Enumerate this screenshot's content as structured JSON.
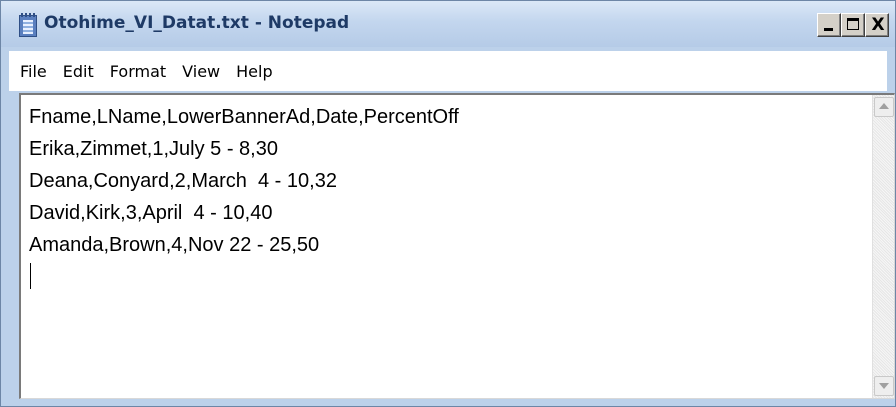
{
  "window": {
    "title": "Otohime_VI_Datat.txt - Notepad",
    "close_glyph": "X"
  },
  "menu": {
    "items": [
      {
        "label": "File"
      },
      {
        "label": "Edit"
      },
      {
        "label": "Format"
      },
      {
        "label": "View"
      },
      {
        "label": "Help"
      }
    ]
  },
  "editor": {
    "content": "Fname,LName,LowerBannerAd,Date,PercentOff\nErika,Zimmet,1,July 5 - 8,30\nDeana,Conyard,2,March  4 - 10,32\nDavid,Kirk,3,April  4 - 10,40\nAmanda,Brown,4,Nov 22 - 25,50"
  },
  "icons": {
    "app": "notepad-icon",
    "minimize": "minimize-icon",
    "maximize": "maximize-icon",
    "close": "close-icon",
    "scroll_up": "scroll-up-arrow-icon",
    "scroll_down": "scroll-down-arrow-icon"
  },
  "colors": {
    "title_text": "#1e3a66",
    "frame": "#bcd1ea"
  }
}
